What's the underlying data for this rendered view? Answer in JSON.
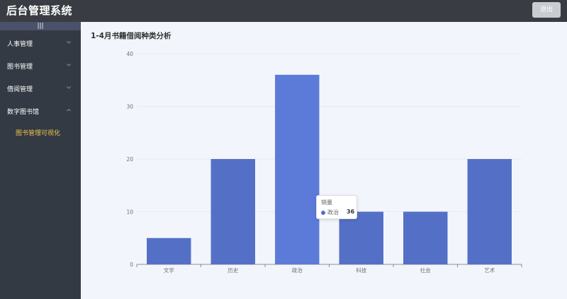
{
  "header": {
    "title": "后台管理系统",
    "logout_label": "退出"
  },
  "sidebar": {
    "collapse_label": "|||",
    "items": [
      {
        "label": "人事管理"
      },
      {
        "label": "图书管理"
      },
      {
        "label": "借阅管理"
      },
      {
        "label": "数字图书馆"
      }
    ],
    "sub_items": [
      {
        "label": "图书管理可视化"
      }
    ]
  },
  "colors": {
    "bar": "#5470c6",
    "bar_highlight": "#5c7bd9",
    "active_text": "#f0c24b"
  },
  "chart_data": {
    "type": "bar",
    "title": "1-4月书籍借阅种类分析",
    "categories": [
      "文学",
      "历史",
      "政治",
      "科技",
      "社会",
      "艺术"
    ],
    "series": [
      {
        "name": "销量",
        "values": [
          5,
          20,
          36,
          10,
          10,
          20
        ]
      }
    ],
    "ylim": [
      0,
      40
    ],
    "yticks": [
      "0",
      "10",
      "20",
      "30",
      "40"
    ],
    "grid": true,
    "highlighted_index": 2
  },
  "tooltip": {
    "title": "销量",
    "name": "政治",
    "value": "36"
  }
}
